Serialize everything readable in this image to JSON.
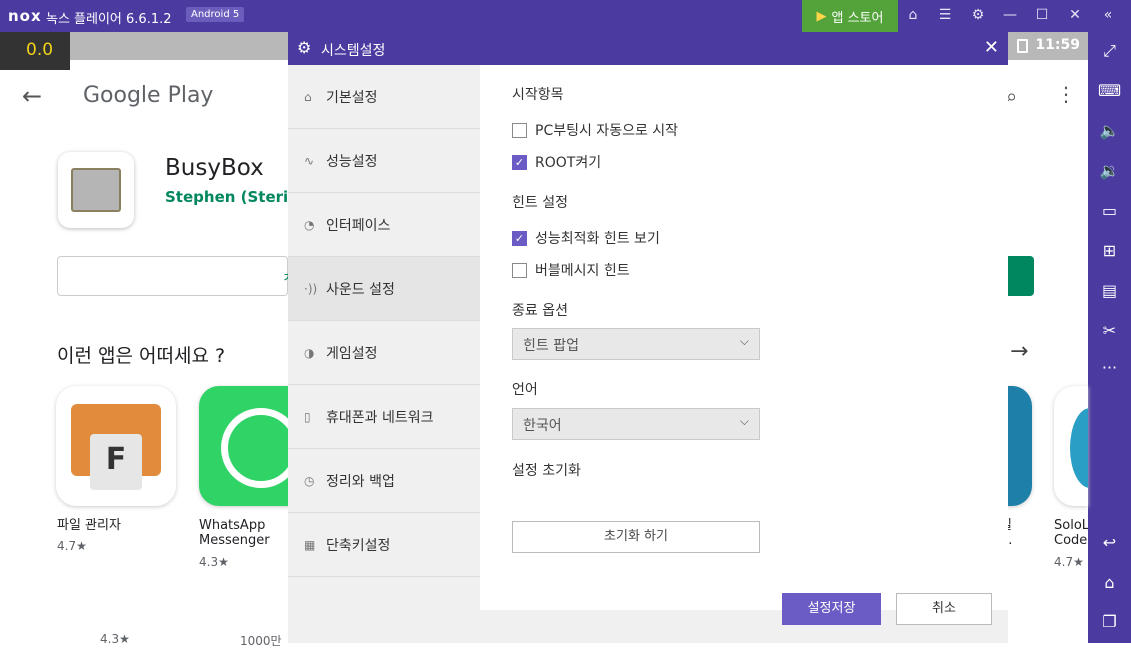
{
  "titlebar": {
    "logo": "nox",
    "title": "녹스 플레이어 6.6.1.2",
    "android_badge": "Android 5",
    "app_store_label": "앱 스토어"
  },
  "statusbar": {
    "fps": "0.0",
    "time": "11:59"
  },
  "play": {
    "logo": "Google Play",
    "app_name": "BusyBox",
    "developer": "Stephen (Stericsc",
    "install_fragment": "ㅊ",
    "recommend_title": "이런 앱은 어떠세요 ?",
    "tiles": [
      {
        "name": "파일 관리자",
        "rating": "4.7★"
      },
      {
        "name": "WhatsApp Messenger",
        "rating": "4.3★"
      },
      {
        "name": "일 ...",
        "rating": ""
      },
      {
        "name": "SoloL Code",
        "rating": "4.7★"
      }
    ],
    "bottom_rating": "4.3★",
    "bottom_count": "1000만"
  },
  "dialog": {
    "title": "시스템설정",
    "menu": [
      {
        "label": "기본설정",
        "icon": "home-icon"
      },
      {
        "label": "성능설정",
        "icon": "pulse-icon"
      },
      {
        "label": "인터페이스",
        "icon": "palette-icon"
      },
      {
        "label": "사운드 설정",
        "icon": "sound-icon"
      },
      {
        "label": "게임설정",
        "icon": "gamepad-icon"
      },
      {
        "label": "휴대폰과 네트워크",
        "icon": "phone-icon"
      },
      {
        "label": "정리와 백업",
        "icon": "history-icon"
      },
      {
        "label": "단축키설정",
        "icon": "keyboard-icon"
      }
    ],
    "active_menu": "사운드 설정",
    "startup_title": "시작항목",
    "opt_autostart": {
      "label": "PC부팅시 자동으로 시작",
      "checked": false
    },
    "opt_root": {
      "label": "ROOT켜기",
      "checked": true
    },
    "hint_title": "힌트 설정",
    "opt_perf_hint": {
      "label": "성능최적화 힌트 보기",
      "checked": true
    },
    "opt_bubble_hint": {
      "label": "버블메시지 힌트",
      "checked": false
    },
    "exit_title": "종료 옵션",
    "exit_value": "힌트 팝업",
    "lang_title": "언어",
    "lang_value": "한국어",
    "reset_title": "설정 초기화",
    "reset_button": "초기화 하기",
    "save_button": "설정저장",
    "cancel_button": "취소"
  }
}
